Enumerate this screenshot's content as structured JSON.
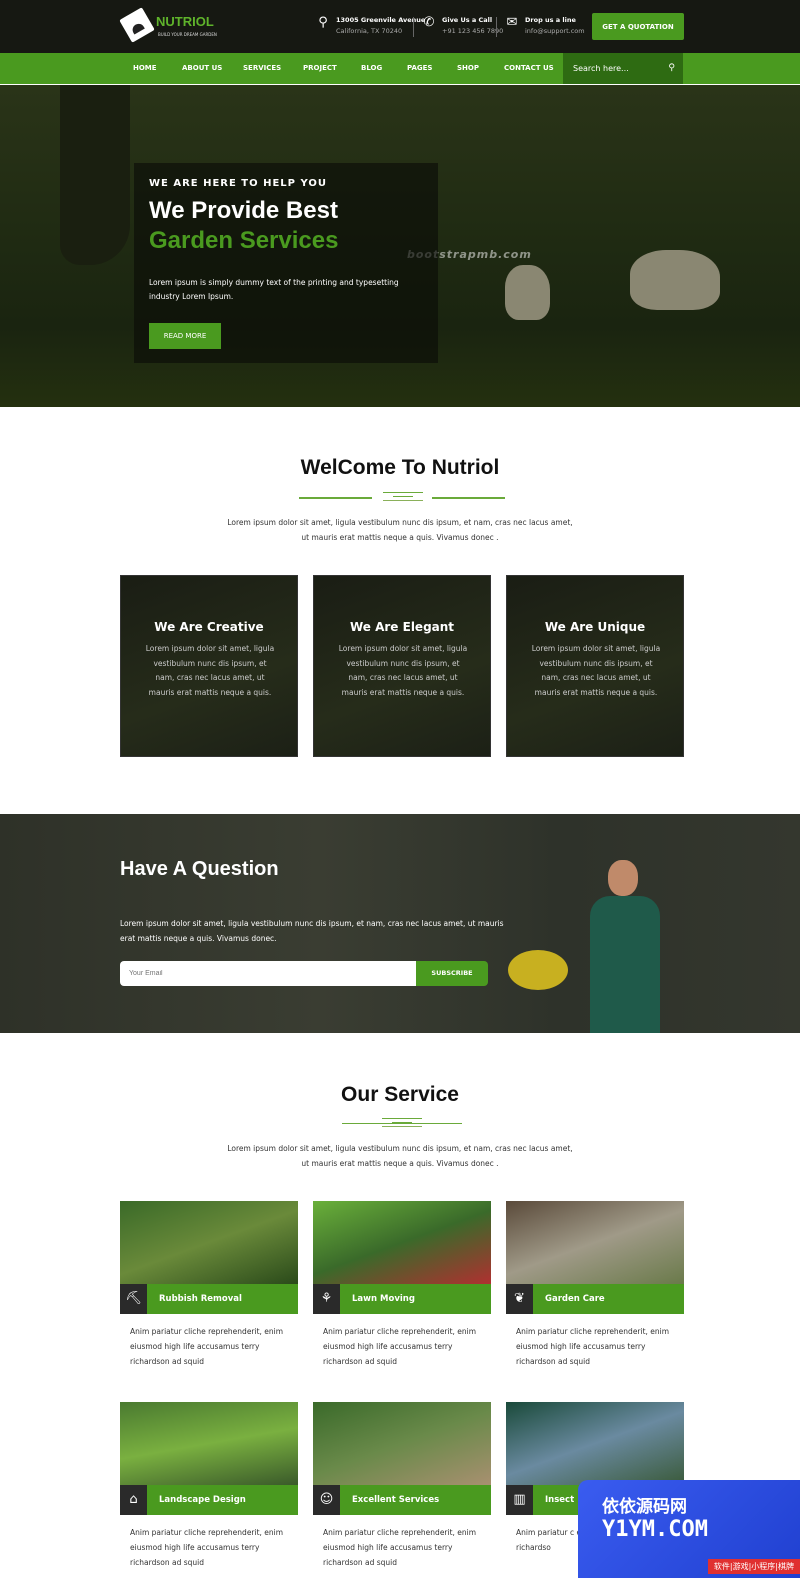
{
  "brand": {
    "name": "NUTRIOL",
    "tagline": "BUILD YOUR DREAM GARDEN"
  },
  "contact": [
    {
      "icon": "map-pin-icon",
      "line1": "13005 Greenvile Avenue",
      "line2": "California, TX 70240"
    },
    {
      "icon": "phone-icon",
      "line1": "Give Us a Call",
      "line2": "+91 123 456 7890"
    },
    {
      "icon": "envelope-icon",
      "line1": "Drop us a line",
      "line2": "info@support.com"
    }
  ],
  "quote_button": "GET A QUOTATION",
  "nav": [
    "HOME",
    "ABOUT US",
    "SERVICES",
    "PROJECT",
    "BLOG",
    "PAGES",
    "SHOP",
    "CONTACT US"
  ],
  "search": {
    "placeholder": "Search here..."
  },
  "hero": {
    "kicker": "WE ARE HERE TO HELP YOU",
    "title1": "We Provide Best",
    "title2": "Garden Services",
    "text": "Lorem ipsum is simply dummy text of the printing and typesetting industry Lorem Ipsum.",
    "button": "READ MORE",
    "watermark": "bootstrapmb.com"
  },
  "welcome": {
    "title": "WelCome To Nutriol",
    "intro1": "Lorem ipsum dolor sit amet, ligula vestibulum nunc dis ipsum, et nam, cras nec lacus amet,",
    "intro2": "ut mauris erat mattis neque a quis. Vivamus donec .",
    "features": [
      {
        "title": "We Are Creative",
        "text": "Lorem ipsum dolor sit amet, ligula vestibulum nunc dis ipsum, et nam, cras nec lacus amet, ut mauris erat mattis neque a quis."
      },
      {
        "title": "We Are Elegant",
        "text": "Lorem ipsum dolor sit amet, ligula vestibulum nunc dis ipsum, et nam, cras nec lacus amet, ut mauris erat mattis neque a quis."
      },
      {
        "title": "We Are Unique",
        "text": "Lorem ipsum dolor sit amet, ligula vestibulum nunc dis ipsum, et nam, cras nec lacus amet, ut mauris erat mattis neque a quis."
      }
    ]
  },
  "question": {
    "title": "Have A Question",
    "text": "Lorem ipsum dolor sit amet, ligula vestibulum nunc dis ipsum, et nam, cras nec lacus amet, ut mauris erat mattis neque a quis. Vivamus donec.",
    "email_placeholder": "Your Email",
    "button": "SUBSCRIBE"
  },
  "services": {
    "title": "Our Service",
    "intro1": "Lorem ipsum dolor sit amet, ligula vestibulum nunc dis ipsum, et nam, cras nec lacus amet,",
    "intro2": "ut mauris erat mattis neque a quis. Vivamus donec .",
    "items": [
      {
        "title": "Rubbish Removal",
        "icon": "shovel-icon",
        "text": "Anim pariatur cliche reprehenderit, enim eiusmod high life accusamus terry richardson ad squid"
      },
      {
        "title": "Lawn Moving",
        "icon": "lawn-mower-icon",
        "text": "Anim pariatur cliche reprehenderit, enim eiusmod high life accusamus terry richardson ad squid"
      },
      {
        "title": "Garden Care",
        "icon": "plant-hand-icon",
        "text": "Anim pariatur cliche reprehenderit, enim eiusmod high life accusamus terry richardson ad squid"
      },
      {
        "title": "Landscape Design",
        "icon": "house-plant-icon",
        "text": "Anim pariatur cliche reprehenderit, enim eiusmod high life accusamus terry richardson ad squid"
      },
      {
        "title": "Excellent Services",
        "icon": "gardener-icon",
        "text": "Anim pariatur cliche reprehenderit, enim eiusmod high life accusamus terry richardson ad squid"
      },
      {
        "title": "Insect",
        "icon": "fence-icon",
        "text": "Anim pariatur c enim eiusmod terry richardso"
      }
    ]
  },
  "badge": {
    "line1": "依依源码网",
    "line2": "Y1YM.COM",
    "line3": "软件|游戏|小程序|棋牌"
  },
  "colors": {
    "brand_green": "#4a9a1f",
    "dark": "#161812"
  }
}
